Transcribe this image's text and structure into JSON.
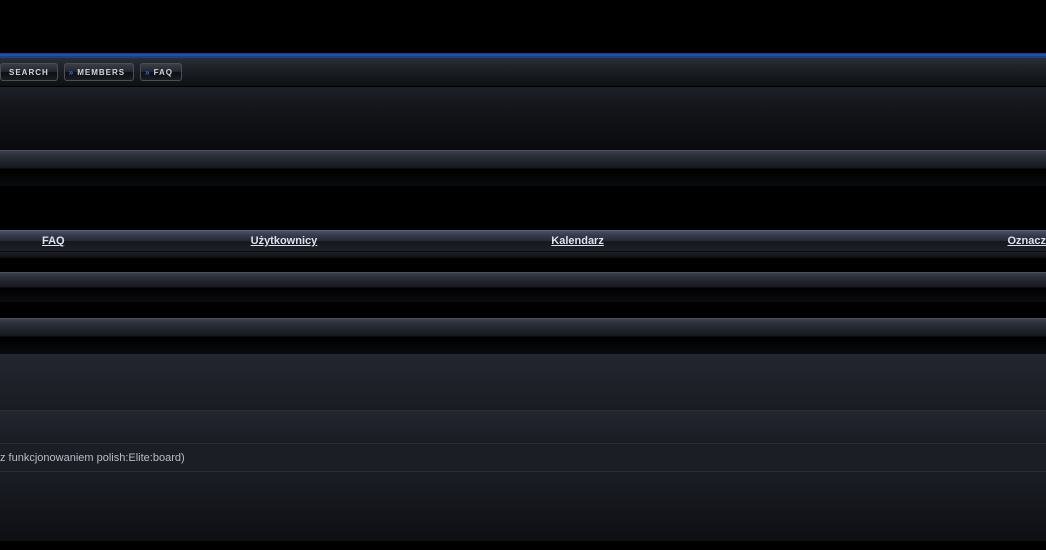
{
  "toolbar": {
    "search_label": "SEARCH",
    "members_label": "MEMBERS",
    "faq_label": "FAQ"
  },
  "navbar": {
    "faq": "FAQ",
    "users": "Użytkownicy",
    "calendar": "Kalendarz",
    "mark": "Oznacz "
  },
  "section": {
    "description": " z funkcjonowaniem polish:Elite:board)"
  }
}
